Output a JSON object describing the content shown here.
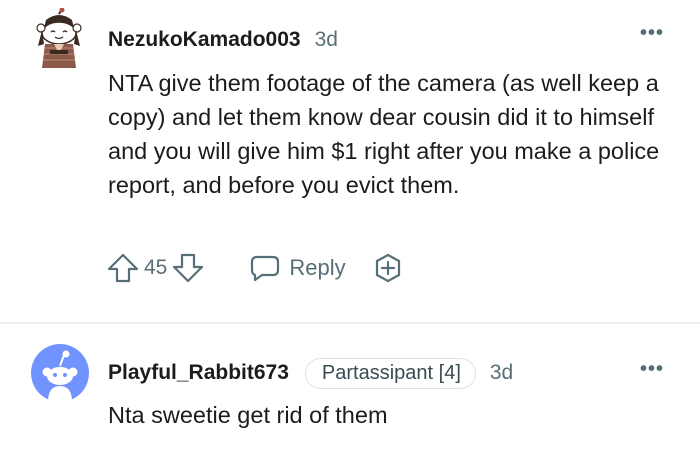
{
  "comments": [
    {
      "username": "NezukoKamado003",
      "time": "3d",
      "body": "NTA give them footage of the camera (as well keep a copy) and let them know dear cousin did it to himself and you will give him $1 right after you make a police report, and before you evict them.",
      "score": "45",
      "reply_label": "Reply",
      "more": "•••"
    },
    {
      "username": "Playful_Rabbit673",
      "flair": "Partassipant [4]",
      "time": "3d",
      "body": "Nta sweetie get rid of them",
      "more": "•••"
    }
  ],
  "colors": {
    "meta_gray": "#576f76",
    "avatar_blue": "#7193ff",
    "divider": "#ededed"
  },
  "icons": [
    "upvote-icon",
    "downvote-icon",
    "reply-bubble-icon",
    "award-icon",
    "more-options-icon"
  ]
}
